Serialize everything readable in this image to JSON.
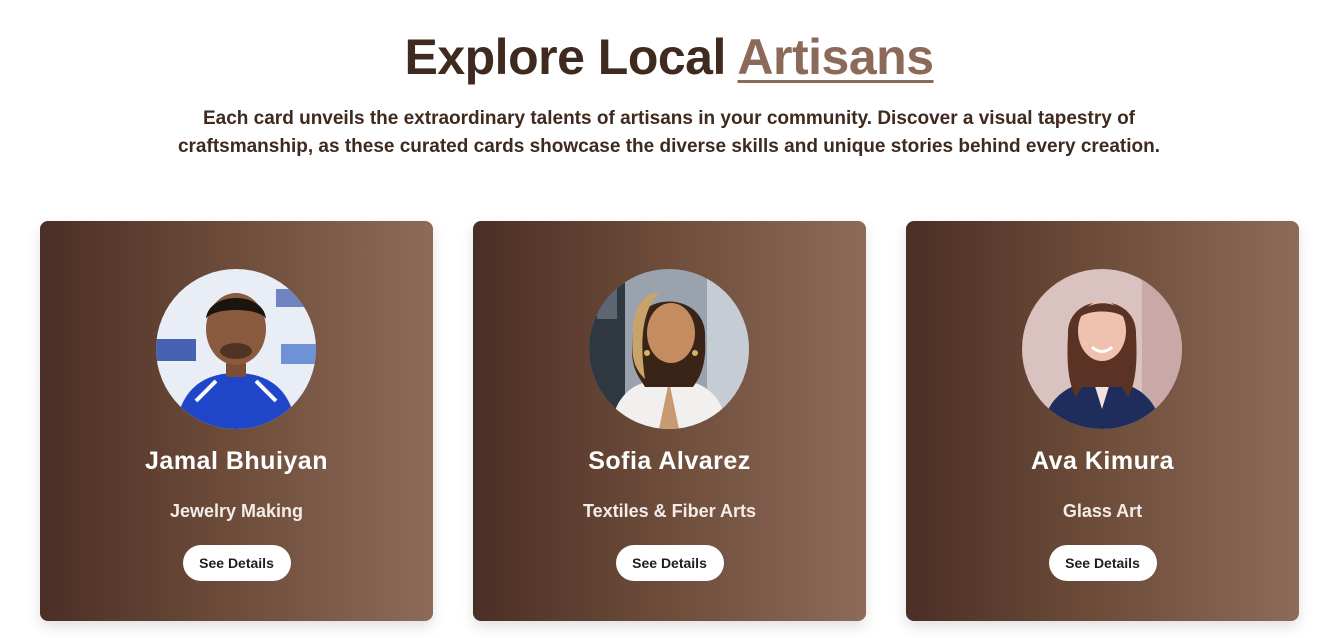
{
  "header": {
    "title_prefix": "Explore Local",
    "title_accent": "Artisans",
    "subtitle": "Each card unveils the extraordinary talents of artisans in your community. Discover a visual tapestry of craftsmanship, as these curated cards showcase the diverse skills and unique stories behind every creation."
  },
  "colors": {
    "heading": "#3f2a1f",
    "accent": "#8b6a5a",
    "card_gradient_start": "#4b2e25",
    "card_gradient_end": "#8e6a59"
  },
  "artisans": [
    {
      "name": "Jamal Bhuiyan",
      "craft": "Jewelry Making",
      "button_label": "See Details",
      "avatar_icon": "person-photo"
    },
    {
      "name": "Sofia Alvarez",
      "craft": "Textiles & Fiber Arts",
      "button_label": "See Details",
      "avatar_icon": "person-photo"
    },
    {
      "name": "Ava Kimura",
      "craft": "Glass Art",
      "button_label": "See Details",
      "avatar_icon": "person-photo"
    }
  ]
}
